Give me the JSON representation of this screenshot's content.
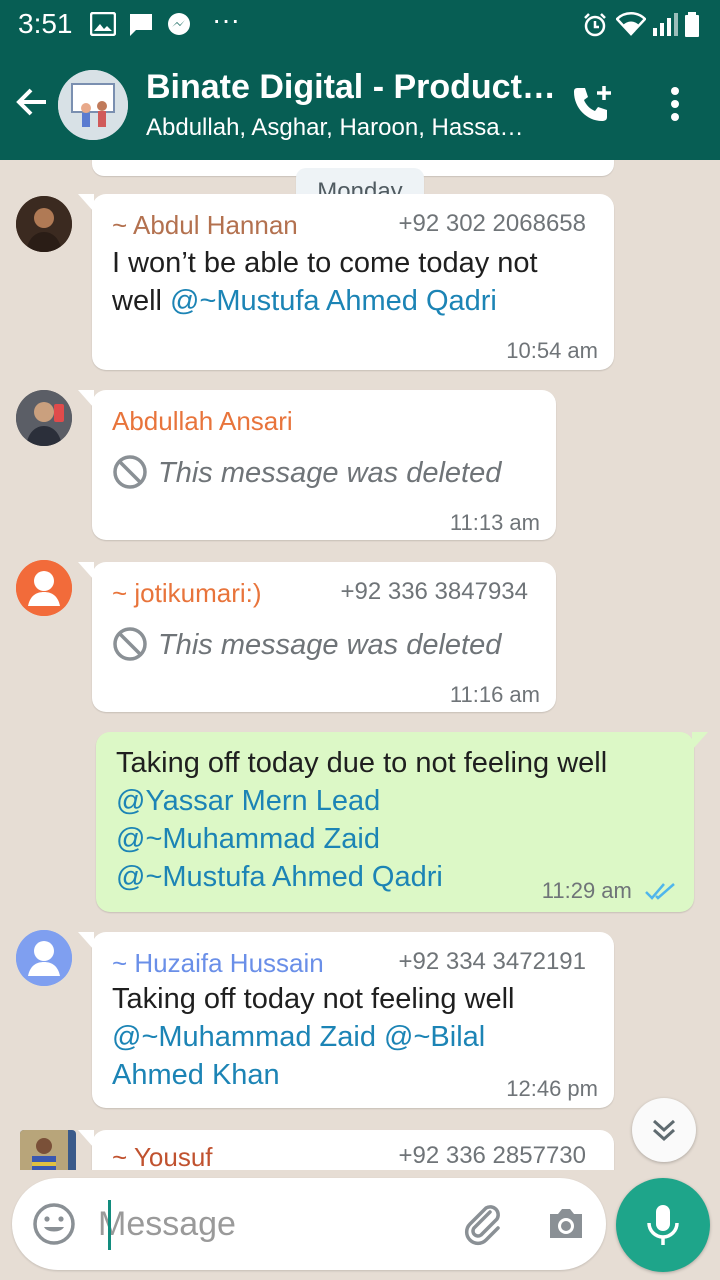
{
  "status": {
    "time": "3:51",
    "dots": "···"
  },
  "header": {
    "title": "Binate Digital - Product…",
    "subtitle": "Abdullah, Asghar, Haroon, Hassa…"
  },
  "chat": {
    "date_chip": "Monday",
    "messages": [
      {
        "sender": "~ Abdul Hannan",
        "sender_color": "#b3714f",
        "phone": "+92 302 2068658",
        "text": "I won’t be able to come today not well ",
        "mention": "@~Mustufa Ahmed Qadri",
        "time": "10:54 am"
      },
      {
        "sender": "Abdullah Ansari",
        "sender_color": "#e8743b",
        "deleted_text": "This message was deleted",
        "time": "11:13 am"
      },
      {
        "sender": "~ jotikumari:)",
        "sender_color": "#e8743b",
        "phone": "+92 336 3847934",
        "deleted_text": "This message was deleted",
        "time": "11:16 am"
      },
      {
        "outgoing": true,
        "text": "Taking off today due to not feeling well",
        "mentions": [
          "@Yassar Mern Lead",
          "@~Muhammad Zaid",
          "@~Mustufa Ahmed Qadri"
        ],
        "time": "11:29 am"
      },
      {
        "sender": "~ Huzaifa Hussain",
        "sender_color": "#6a8fe8",
        "phone": "+92 334 3472191",
        "text": "Taking off today not feeling well",
        "mention1": "@~Muhammad Zaid",
        "mention2": "@~Bilal",
        "mention3": "Ahmed Khan",
        "time": "12:46 pm"
      },
      {
        "sender": "~ Yousuf",
        "sender_color": "#c0522f",
        "phone": "+92 336 2857730"
      }
    ]
  },
  "composer": {
    "placeholder": "Message"
  },
  "colors": {
    "header": "#075e54",
    "outgoing": "#dcf8c6",
    "mention": "#1c84b5",
    "mic": "#1ea58a"
  }
}
